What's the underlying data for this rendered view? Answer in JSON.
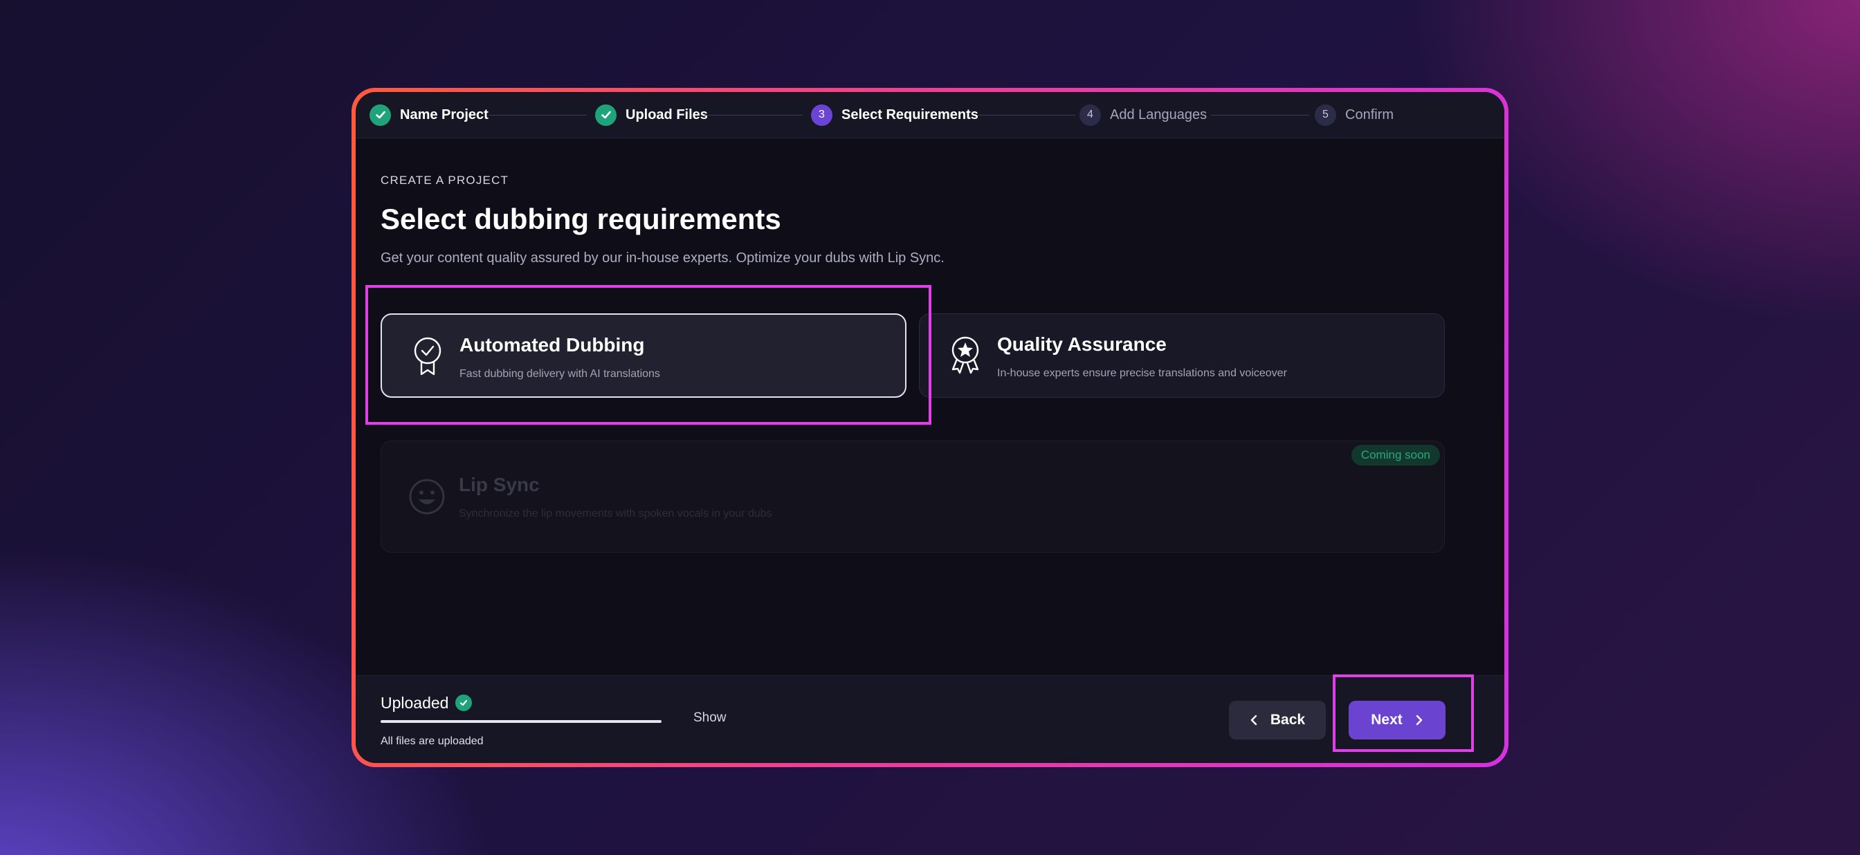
{
  "stepper": {
    "steps": [
      {
        "label": "Name Project",
        "state": "done",
        "number": ""
      },
      {
        "label": "Upload Files",
        "state": "done",
        "number": ""
      },
      {
        "label": "Select Requirements",
        "state": "active",
        "number": "3"
      },
      {
        "label": "Add Languages",
        "state": "todo",
        "number": "4"
      },
      {
        "label": "Confirm",
        "state": "todo",
        "number": "5"
      }
    ]
  },
  "header": {
    "kicker": "CREATE A PROJECT",
    "title": "Select dubbing requirements",
    "subtitle": "Get your content quality assured by our in-house experts. Optimize your dubs with Lip Sync."
  },
  "options": [
    {
      "title": "Automated Dubbing",
      "description": "Fast dubbing delivery with AI translations",
      "icon": "ribbon-check-icon",
      "selected": true
    },
    {
      "title": "Quality Assurance",
      "description": "In-house experts ensure precise translations and voiceover",
      "icon": "award-star-icon",
      "selected": false
    },
    {
      "title": "Lip Sync",
      "description": "Synchronize the lip movements with spoken vocals in your dubs",
      "icon": "smile-icon",
      "disabled": true,
      "badge": "Coming soon"
    }
  ],
  "footer": {
    "upload_label": "Uploaded",
    "upload_sub": "All files are uploaded",
    "progress_fraction": 1.0,
    "show_label": "Show",
    "back_label": "Back",
    "next_label": "Next"
  },
  "colors": {
    "accent": "#6a43d0",
    "success": "#1fa37a",
    "highlight": "#e13fe8"
  }
}
